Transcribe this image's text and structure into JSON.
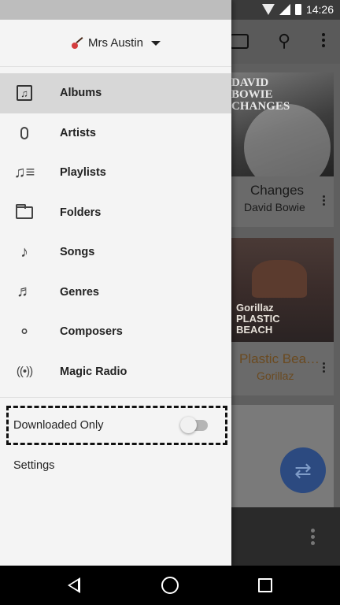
{
  "status_bar": {
    "time": "14:26"
  },
  "account": {
    "name": "Mrs Austin"
  },
  "nav": {
    "items": [
      {
        "label": "Albums",
        "icon": "album-icon"
      },
      {
        "label": "Artists",
        "icon": "microphone-icon"
      },
      {
        "label": "Playlists",
        "icon": "playlist-icon"
      },
      {
        "label": "Folders",
        "icon": "folder-icon"
      },
      {
        "label": "Songs",
        "icon": "music-note-icon"
      },
      {
        "label": "Genres",
        "icon": "genre-icon"
      },
      {
        "label": "Composers",
        "icon": "lyre-icon"
      },
      {
        "label": "Magic Radio",
        "icon": "radio-icon"
      }
    ]
  },
  "downloaded_only": {
    "label": "Downloaded Only",
    "enabled": false
  },
  "settings": {
    "label": "Settings"
  },
  "background": {
    "album1": {
      "art_text": "DAVID\nBOWIE\nCHANGES",
      "title": "Changes",
      "artist": "David Bowie"
    },
    "album2": {
      "art_text": "Gorillaz\nPLASTIC\nBEACH",
      "title": "Plastic Bea…",
      "artist": "Gorillaz"
    }
  }
}
